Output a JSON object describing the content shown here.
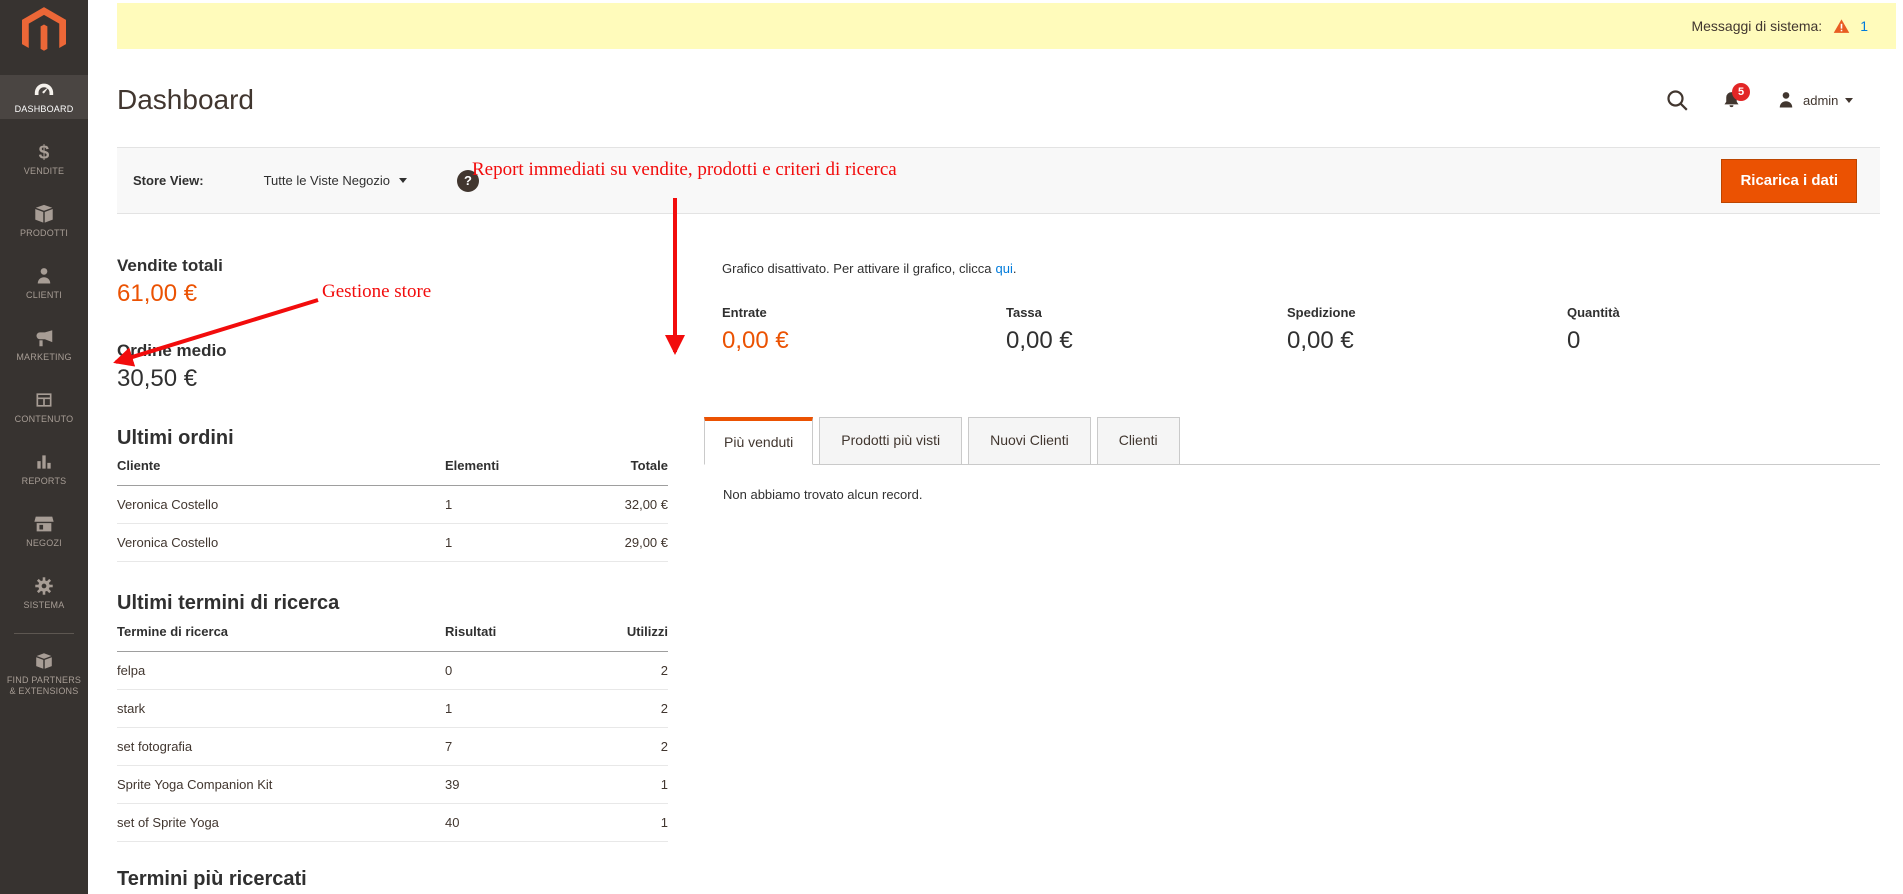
{
  "system_bar": {
    "label": "Messaggi di sistema:",
    "count": "1"
  },
  "header": {
    "title": "Dashboard",
    "user": "admin",
    "notification_count": "5"
  },
  "sidebar": {
    "items": [
      {
        "label": "DASHBOARD",
        "icon": "gauge-icon",
        "active": true
      },
      {
        "label": "VENDITE",
        "icon": "dollar-icon"
      },
      {
        "label": "PRODOTTI",
        "icon": "box-icon"
      },
      {
        "label": "CLIENTI",
        "icon": "person-icon"
      },
      {
        "label": "MARKETING",
        "icon": "megaphone-icon"
      },
      {
        "label": "CONTENUTO",
        "icon": "layout-icon"
      },
      {
        "label": "REPORTS",
        "icon": "bar-chart-icon"
      },
      {
        "label": "NEGOZI",
        "icon": "storefront-icon"
      },
      {
        "label": "SISTEMA",
        "icon": "gear-icon"
      },
      {
        "label": "FIND PARTNERS & EXTENSIONS",
        "icon": "brick-icon"
      }
    ]
  },
  "toolbar": {
    "store_view_label": "Store View:",
    "store_view_value": "Tutte le Viste Negozio",
    "help_glyph": "?",
    "reload_button": "Ricarica i dati"
  },
  "annotations": {
    "note_top": "Report immediati su vendite, prodotti e criteri di ricerca",
    "note_left": "Gestione store",
    "color": "#f20c0c"
  },
  "stats": {
    "total_sales_label": "Vendite totali",
    "total_sales_value": "61,00 €",
    "avg_order_label": "Ordine medio",
    "avg_order_value": "30,50 €"
  },
  "chart_notice": {
    "text": "Grafico disattivato. Per attivare il grafico, clicca",
    "link": "qui",
    "suffix": "."
  },
  "metrics": [
    {
      "label": "Entrate",
      "value": "0,00 €",
      "highlight": true
    },
    {
      "label": "Tassa",
      "value": "0,00 €",
      "highlight": false
    },
    {
      "label": "Spedizione",
      "value": "0,00 €",
      "highlight": false
    },
    {
      "label": "Quantità",
      "value": "0",
      "highlight": false
    }
  ],
  "tabs": {
    "items": [
      {
        "label": "Più venduti",
        "active": true
      },
      {
        "label": "Prodotti più visti",
        "active": false
      },
      {
        "label": "Nuovi Clienti",
        "active": false
      },
      {
        "label": "Clienti",
        "active": false
      }
    ],
    "empty_text": "Non abbiamo trovato alcun record."
  },
  "last_orders": {
    "title": "Ultimi ordini",
    "columns": [
      "Cliente",
      "Elementi",
      "Totale"
    ],
    "rows": [
      [
        "Veronica Costello",
        "1",
        "32,00 €"
      ],
      [
        "Veronica Costello",
        "1",
        "29,00 €"
      ]
    ]
  },
  "last_search_terms": {
    "title": "Ultimi termini di ricerca",
    "columns": [
      "Termine di ricerca",
      "Risultati",
      "Utilizzi"
    ],
    "rows": [
      [
        "felpa",
        "0",
        "2"
      ],
      [
        "stark",
        "1",
        "2"
      ],
      [
        "set fotografia",
        "7",
        "2"
      ],
      [
        "Sprite Yoga Companion Kit",
        "39",
        "1"
      ],
      [
        "set of Sprite Yoga",
        "40",
        "1"
      ]
    ]
  },
  "top_search_terms": {
    "title": "Termini più ricercati"
  },
  "colors": {
    "accent_orange": "#eb5202",
    "logo_orange": "#ec6737",
    "link_blue": "#007bdb",
    "badge_red": "#e22626",
    "system_bar_yellow": "#fffbbb",
    "sidebar_dark": "#373330",
    "sidebar_active": "#4a4542",
    "annotation_red": "#f20c0c"
  }
}
